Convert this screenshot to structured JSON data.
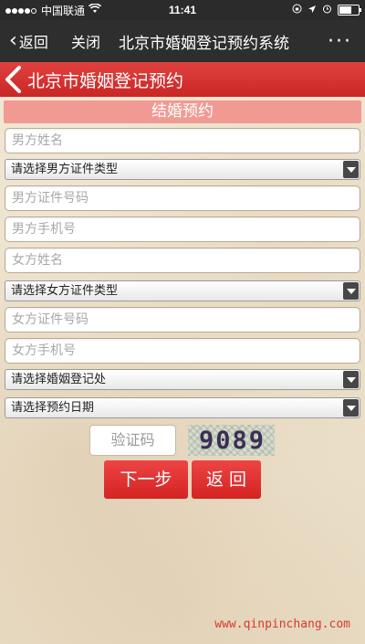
{
  "status_bar": {
    "carrier": "中国联通",
    "time": "11:41"
  },
  "nav": {
    "back_label": "返回",
    "close_label": "关闭",
    "title": "北京市婚姻登记预约系统",
    "more": "···"
  },
  "header": {
    "title": "北京市婚姻登记预约"
  },
  "form": {
    "section_title": "结婚预约",
    "male_name_placeholder": "男方姓名",
    "male_id_type": "请选择男方证件类型",
    "male_id_number_placeholder": "男方证件号码",
    "male_phone_placeholder": "男方手机号",
    "female_name_placeholder": "女方姓名",
    "female_id_type": "请选择女方证件类型",
    "female_id_number_placeholder": "女方证件号码",
    "female_phone_placeholder": "女方手机号",
    "office_select": "请选择婚姻登记处",
    "date_select": "请选择预约日期",
    "captcha_placeholder": "验证码",
    "captcha_code": "9089",
    "next_button": "下一步",
    "return_button": "返 回"
  },
  "watermark": "www.qinpinchang.com",
  "colors": {
    "accent_red": "#d42323",
    "section_pink": "#f19a93",
    "nav_dark": "#2e2e2e"
  }
}
